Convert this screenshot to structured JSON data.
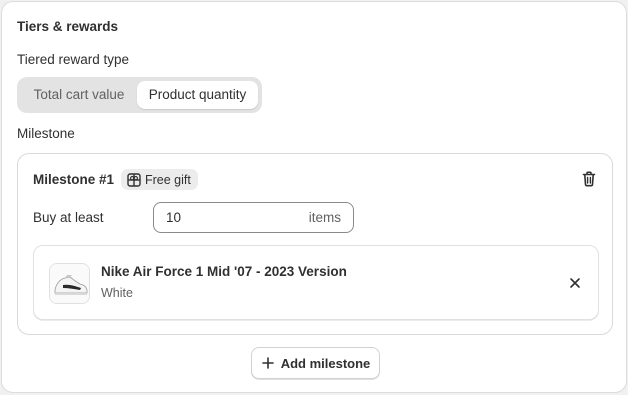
{
  "section": {
    "title": "Tiers & rewards",
    "reward_type_label": "Tiered reward type",
    "reward_type_options": [
      "Total cart value",
      "Product quantity"
    ],
    "reward_type_selected": "Product quantity",
    "milestone_label": "Milestone"
  },
  "milestone": {
    "title": "Milestone #1",
    "badge_label": "Free gift",
    "buy_label": "Buy at least",
    "quantity_value": "10",
    "quantity_suffix": "items",
    "product": {
      "name": "Nike Air Force 1 Mid '07 - 2023 Version",
      "variant": "White"
    }
  },
  "actions": {
    "add_milestone_label": "Add milestone"
  },
  "icons": {
    "badge": "gift-icon",
    "delete": "trash-icon",
    "remove": "close-icon",
    "add": "plus-icon"
  },
  "colors": {
    "text": "#303030",
    "muted": "#616161",
    "segment_bg": "#e3e3e3",
    "card_bg": "#ffffff"
  }
}
